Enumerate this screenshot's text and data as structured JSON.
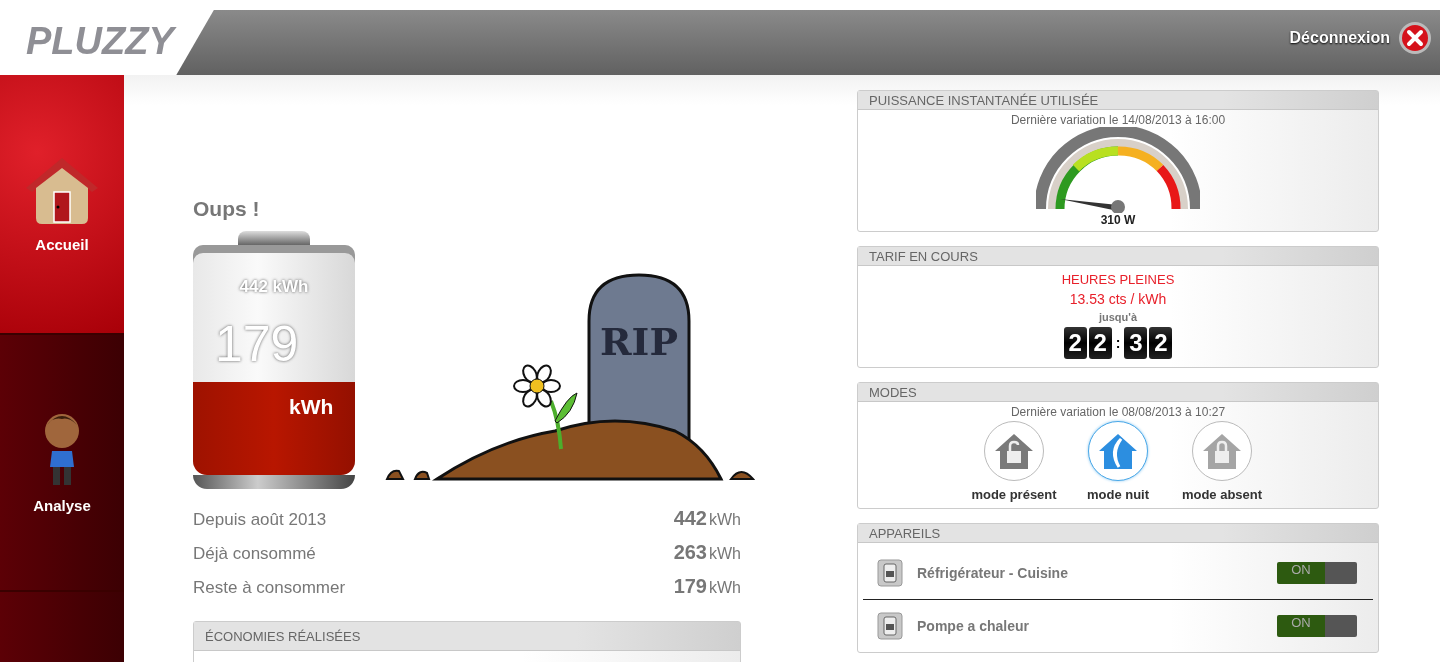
{
  "header": {
    "logo": "PLUZZY",
    "logout": "Déconnexion"
  },
  "sidebar": {
    "items": [
      {
        "label": "Accueil",
        "kind": "home",
        "selected": true
      },
      {
        "label": "Analyse",
        "kind": "person",
        "selected": false
      },
      {
        "kind": "blank",
        "selected": false
      }
    ]
  },
  "summary": {
    "title": "Oups !",
    "battery": {
      "total": "442 kWh",
      "remaining": "179",
      "unit": "kWh",
      "level": 0.405
    },
    "rows": [
      {
        "label": "Depuis août 2013",
        "value": "442",
        "unit": "kWh"
      },
      {
        "label": "Déjà consommé",
        "value": "263",
        "unit": "kWh"
      },
      {
        "label": "Reste à consommer",
        "value": "179",
        "unit": "kWh"
      }
    ],
    "tombstone": "RIP",
    "savings_title": "ÉCONOMIES RÉALISÉES"
  },
  "power": {
    "title": "PUISSANCE INSTANTANÉE UTILISÉE",
    "subtitle": "Dernière variation le 14/08/2013 à 16:00",
    "reading": "310 W"
  },
  "tariff": {
    "title": "TARIF EN COURS",
    "period": "HEURES PLEINES",
    "price": "13.53 cts / kWh",
    "until": "jusqu'à",
    "digits": [
      "2",
      "2",
      "3",
      "2"
    ],
    "separator": ":"
  },
  "modes": {
    "title": "MODES",
    "subtitle": "Dernière variation le 08/08/2013 à 10:27",
    "items": [
      {
        "label": "mode présent",
        "kind": "open",
        "selected": false
      },
      {
        "label": "mode nuit",
        "kind": "night",
        "selected": true
      },
      {
        "label": "mode absent",
        "kind": "locked",
        "selected": false
      }
    ]
  },
  "devices": {
    "title": "APPAREILS",
    "items": [
      {
        "name": "Réfrigérateur - Cuisine",
        "state": "ON",
        "on": true
      },
      {
        "name": "Pompe a chaleur",
        "state": "ON",
        "on": true
      }
    ]
  }
}
